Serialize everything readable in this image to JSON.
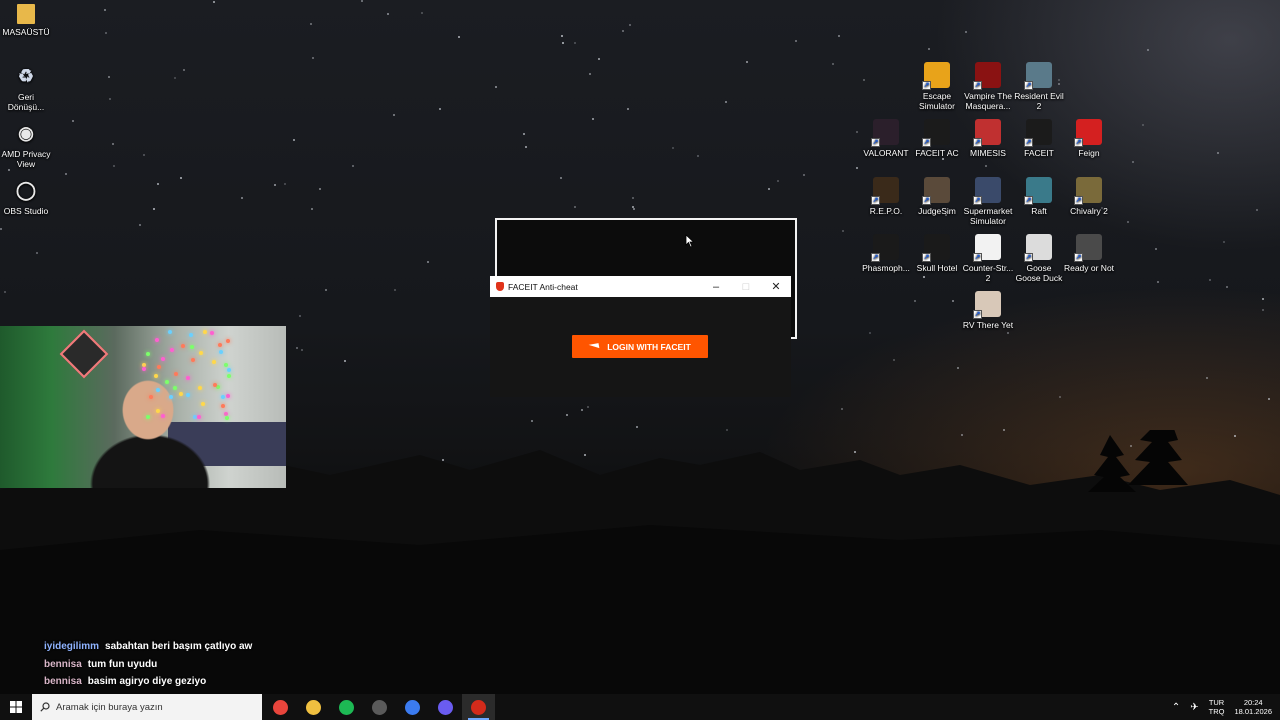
{
  "desktop_left": [
    {
      "label": "MASAÜSTÜ",
      "icon": "folder-icon"
    },
    {
      "label": "Geri Dönüşü...",
      "icon": "recycle-bin-icon"
    },
    {
      "label": "AMD Privacy View",
      "icon": "amd-privacy-view-icon"
    },
    {
      "label": "OBS Studio",
      "icon": "obs-studio-icon"
    }
  ],
  "desktop_right": [
    {
      "label": "Escape Simulator",
      "icon": "escape-simulator-icon",
      "color": "#e8a31a"
    },
    {
      "label": "Vampire The Masquera...",
      "icon": "vampire-masquerade-icon",
      "color": "#8a1212"
    },
    {
      "label": "Resident Evil 2",
      "icon": "resident-evil-2-icon",
      "color": "#5a7a8a"
    },
    {
      "label": "VALORANT",
      "icon": "valorant-icon",
      "color": "#2b1f2b"
    },
    {
      "label": "FACEIT AC",
      "icon": "faceit-ac-icon",
      "color": "#1b1b1b"
    },
    {
      "label": "MIMESIS",
      "icon": "mimesis-icon",
      "color": "#c03030"
    },
    {
      "label": "FACEIT",
      "icon": "faceit-icon",
      "color": "#1b1b1b"
    },
    {
      "label": "Feign",
      "icon": "feign-icon",
      "color": "#d42020"
    },
    {
      "label": "R.E.P.O.",
      "icon": "repo-icon",
      "color": "#3a2a1a"
    },
    {
      "label": "JudgeSim",
      "icon": "judgesim-icon",
      "color": "#5a4a3a"
    },
    {
      "label": "Supermarket Simulator",
      "icon": "supermarket-simulator-icon",
      "color": "#3a4a6a"
    },
    {
      "label": "Raft",
      "icon": "raft-icon",
      "color": "#3a7a8a"
    },
    {
      "label": "Chivalry 2",
      "icon": "chivalry-2-icon",
      "color": "#7a6a3a"
    },
    {
      "label": "Phasmoph...",
      "icon": "phasmophobia-icon",
      "color": "#1a1a1a"
    },
    {
      "label": "Skull Hotel",
      "icon": "skull-hotel-icon",
      "color": "#1a1a1a"
    },
    {
      "label": "Counter-Str... 2",
      "icon": "counter-strike-2-icon",
      "color": "#f2f2f2"
    },
    {
      "label": "Goose Goose Duck",
      "icon": "goose-goose-duck-icon",
      "color": "#dcdcdc"
    },
    {
      "label": "Ready or Not",
      "icon": "ready-or-not-icon",
      "color": "#4a4a4a"
    },
    {
      "label": "RV There Yet",
      "icon": "rv-there-yet-icon",
      "color": "#d8c8b8"
    }
  ],
  "faceit_window": {
    "title": "FACEIT Anti-cheat",
    "login_label": "LOGIN WITH FACEIT"
  },
  "chat": [
    {
      "user": "iyidegilimm",
      "message": "sabahtan beri başım çatlıyo aw",
      "alt": false
    },
    {
      "user": "bennisa",
      "message": "tum fun uyudu",
      "alt": true
    },
    {
      "user": "bennisa",
      "message": "basim agiryo diye geziyo",
      "alt": true
    }
  ],
  "taskbar": {
    "search_placeholder": "Aramak için buraya yazın",
    "apps": [
      {
        "name": "chrome-icon",
        "color": "#e8453c",
        "active": false
      },
      {
        "name": "file-explorer-icon",
        "color": "#f0c040",
        "active": false
      },
      {
        "name": "spotify-icon",
        "color": "#1db954",
        "active": false
      },
      {
        "name": "obs-taskbar-icon",
        "color": "#5a5a5a",
        "active": false
      },
      {
        "name": "app-blue-icon",
        "color": "#3b7bf0",
        "active": false
      },
      {
        "name": "discord-icon",
        "color": "#6a5cf0",
        "active": false
      },
      {
        "name": "faceit-ac-taskbar-icon",
        "color": "#d32b1b",
        "active": true
      }
    ],
    "lang_top": "TUR",
    "lang_bottom": "TRQ",
    "time": "20:24",
    "date": "18.01.2026"
  }
}
